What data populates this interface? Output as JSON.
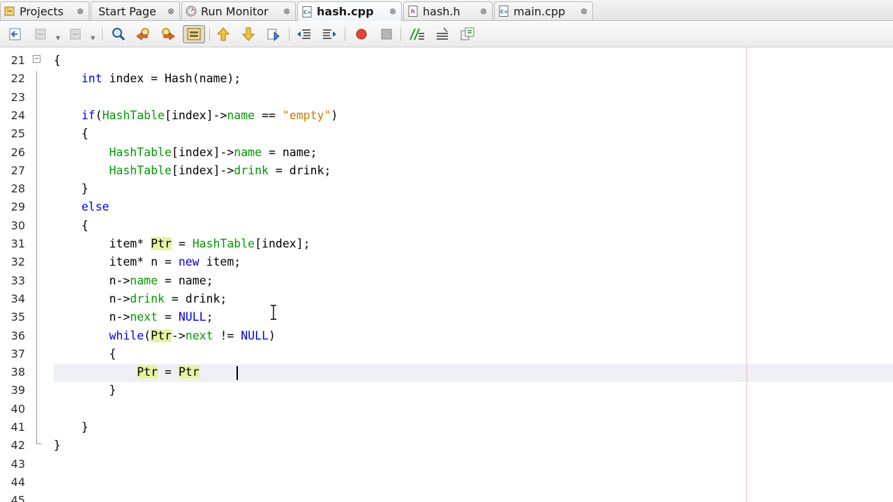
{
  "tabs": [
    {
      "label": "Projects",
      "icon": "projects-icon",
      "active": false
    },
    {
      "label": "Start Page",
      "icon": "start-page-icon",
      "active": false
    },
    {
      "label": "Run Monitor",
      "icon": "run-monitor-icon",
      "active": false
    },
    {
      "label": "hash.cpp",
      "icon": "cpp-file-icon",
      "active": true
    },
    {
      "label": "hash.h",
      "icon": "header-file-icon",
      "active": false
    },
    {
      "label": "main.cpp",
      "icon": "cpp-file-icon",
      "active": false
    }
  ],
  "tab_close_glyph": "⊗",
  "toolbar": {
    "buttons": [
      "last-edit-icon",
      "back-icon",
      "forward-icon",
      "find-selection-icon",
      "find-previous-icon",
      "find-next-icon",
      "toggle-highlight-icon",
      "previous-bookmark-icon",
      "next-bookmark-icon",
      "toggle-bookmark-icon",
      "shift-left-icon",
      "shift-right-icon",
      "start-macro-icon",
      "stop-macro-icon",
      "comment-icon",
      "uncomment-icon",
      "diff-icon"
    ]
  },
  "colors": {
    "keyword": "#0000e6",
    "field": "#009900",
    "string": "#ce7b00",
    "highlight": "#e8f2a2",
    "current_line": "#eef0f6",
    "margin_line": "#f0b6b6"
  },
  "editor": {
    "fold_expanded_glyph": "−",
    "lines": [
      {
        "num": "21",
        "tokens": [
          {
            "t": "{"
          }
        ]
      },
      {
        "num": "22",
        "tokens": [
          {
            "t": "    "
          },
          {
            "t": "int",
            "c": "kw"
          },
          {
            "t": " index = Hash(name);"
          }
        ]
      },
      {
        "num": "23",
        "tokens": []
      },
      {
        "num": "24",
        "tokens": [
          {
            "t": "    "
          },
          {
            "t": "if",
            "c": "kw"
          },
          {
            "t": "("
          },
          {
            "t": "HashTable",
            "c": "fld"
          },
          {
            "t": "[index]->"
          },
          {
            "t": "name",
            "c": "fld"
          },
          {
            "t": " == "
          },
          {
            "t": "\"empty\"",
            "c": "str"
          },
          {
            "t": ")"
          }
        ]
      },
      {
        "num": "25",
        "tokens": [
          {
            "t": "    {"
          }
        ]
      },
      {
        "num": "26",
        "tokens": [
          {
            "t": "        "
          },
          {
            "t": "HashTable",
            "c": "fld"
          },
          {
            "t": "[index]->"
          },
          {
            "t": "name",
            "c": "fld"
          },
          {
            "t": " = name;"
          }
        ]
      },
      {
        "num": "27",
        "tokens": [
          {
            "t": "        "
          },
          {
            "t": "HashTable",
            "c": "fld"
          },
          {
            "t": "[index]->"
          },
          {
            "t": "drink",
            "c": "fld"
          },
          {
            "t": " = drink;"
          }
        ]
      },
      {
        "num": "28",
        "tokens": [
          {
            "t": "    }"
          }
        ]
      },
      {
        "num": "29",
        "tokens": [
          {
            "t": "    "
          },
          {
            "t": "else",
            "c": "kw"
          }
        ]
      },
      {
        "num": "30",
        "tokens": [
          {
            "t": "    {"
          }
        ]
      },
      {
        "num": "31",
        "tokens": [
          {
            "t": "        item* "
          },
          {
            "t": "Ptr",
            "c": "hl"
          },
          {
            "t": " = "
          },
          {
            "t": "HashTable",
            "c": "fld"
          },
          {
            "t": "[index];"
          }
        ]
      },
      {
        "num": "32",
        "tokens": [
          {
            "t": "        item* n = "
          },
          {
            "t": "new",
            "c": "kw"
          },
          {
            "t": " item;"
          }
        ]
      },
      {
        "num": "33",
        "tokens": [
          {
            "t": "        n->"
          },
          {
            "t": "name",
            "c": "fld"
          },
          {
            "t": " = name;"
          }
        ]
      },
      {
        "num": "34",
        "tokens": [
          {
            "t": "        n->"
          },
          {
            "t": "drink",
            "c": "fld"
          },
          {
            "t": " = drink;"
          }
        ]
      },
      {
        "num": "35",
        "tokens": [
          {
            "t": "        n->"
          },
          {
            "t": "next",
            "c": "fld"
          },
          {
            "t": " = "
          },
          {
            "t": "NULL",
            "c": "kw"
          },
          {
            "t": ";"
          }
        ]
      },
      {
        "num": "36",
        "tokens": [
          {
            "t": "        "
          },
          {
            "t": "while",
            "c": "kw"
          },
          {
            "t": "("
          },
          {
            "t": "Ptr",
            "c": "hl"
          },
          {
            "t": "->"
          },
          {
            "t": "next",
            "c": "fld"
          },
          {
            "t": " != "
          },
          {
            "t": "NULL",
            "c": "kw"
          },
          {
            "t": ")"
          }
        ]
      },
      {
        "num": "37",
        "tokens": [
          {
            "t": "        {"
          }
        ]
      },
      {
        "num": "38",
        "tokens": [
          {
            "t": "            "
          },
          {
            "t": "Ptr",
            "c": "hl"
          },
          {
            "t": " = "
          },
          {
            "t": "Ptr",
            "c": "hl"
          }
        ]
      },
      {
        "num": "39",
        "tokens": [
          {
            "t": "        }"
          }
        ]
      },
      {
        "num": "40",
        "tokens": []
      },
      {
        "num": "41",
        "tokens": [
          {
            "t": "    }"
          }
        ]
      },
      {
        "num": "42",
        "tokens": [
          {
            "t": "}"
          }
        ]
      },
      {
        "num": "43",
        "tokens": []
      },
      {
        "num": "44",
        "tokens": []
      },
      {
        "num": "45",
        "tokens": []
      }
    ]
  }
}
